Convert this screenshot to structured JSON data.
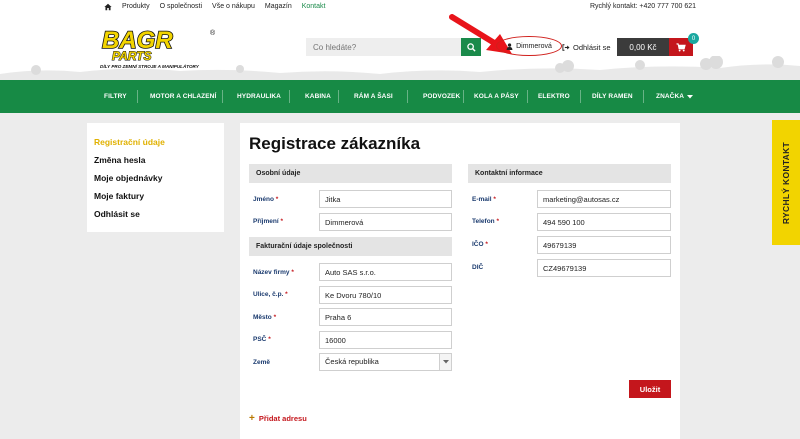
{
  "topbar": {
    "nav": [
      "Produkty",
      "O společnosti",
      "Vše o nákupu",
      "Magazín",
      "Kontakt"
    ],
    "active_index": 4,
    "quick_contact": "Rychlý kontakt: +420 777 700 621"
  },
  "header": {
    "logo_main": "BAGR",
    "logo_sub": "PARTS",
    "logo_tagline": "DÍLY PRO ZEMNÍ STROJE A MANIPULÁTORY",
    "logo_reg": "®",
    "search_placeholder": "Co hledáte?",
    "user_name": "Dimmerová",
    "logout_label": "Odhlásit se",
    "cart_amount": "0,00 Kč",
    "cart_count": "0"
  },
  "mainnav": [
    "FILTRY",
    "MOTOR A CHLAZENÍ",
    "HYDRAULIKA",
    "KABINA",
    "RÁM A ŠASI",
    "PODVOZEK",
    "KOLA A PÁSY",
    "ELEKTRO",
    "DÍLY RAMEN",
    "ZNAČKA"
  ],
  "sidebar": {
    "items": [
      "Registrační údaje",
      "Změna hesla",
      "Moje objednávky",
      "Moje faktury",
      "Odhlásit se"
    ],
    "active_index": 0
  },
  "form": {
    "title": "Registrace zákazníka",
    "personal": {
      "heading": "Osobní údaje",
      "first_name_label": "Jméno",
      "first_name": "Jitka",
      "last_name_label": "Příjmení",
      "last_name": "Dimmerová"
    },
    "billing": {
      "heading": "Fakturační údaje společnosti",
      "company_label": "Název firmy",
      "company": "Auto SAS s.r.o.",
      "street_label": "Ulice, č.p.",
      "street": "Ke Dvoru 780/10",
      "city_label": "Město",
      "city": "Praha 6",
      "zip_label": "PSČ",
      "zip": "16000",
      "country_label": "Země",
      "country": "Česká republika"
    },
    "contact": {
      "heading": "Kontaktní informace",
      "email_label": "E-mail",
      "email": "marketing@autosas.cz",
      "phone_label": "Telefon",
      "phone": "494 590 100",
      "ico_label": "IČO",
      "ico": "49679139",
      "dic_label": "DIČ",
      "dic": "CZ49679139"
    },
    "required_mark": "*",
    "save_label": "Uložit",
    "add_address_label": "Přidat adresu",
    "add_address_icon": "+"
  },
  "quick_tab": "RYCHLÝ KONTAKT",
  "colors": {
    "brand_green": "#178a45",
    "brand_yellow": "#f2d400",
    "accent_red": "#c4161c",
    "active_yellow": "#e0b100"
  }
}
